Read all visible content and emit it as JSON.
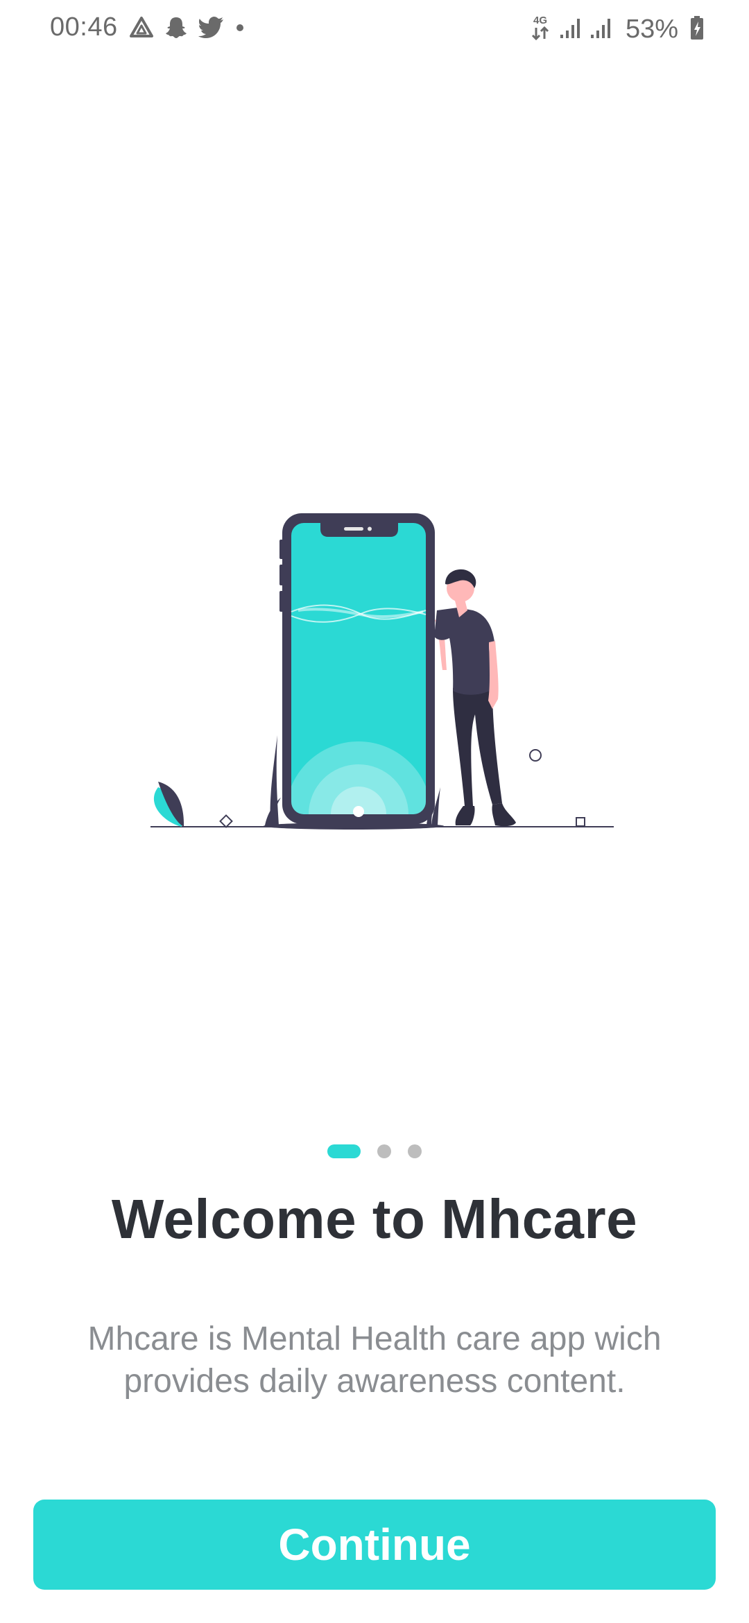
{
  "status_bar": {
    "time": "00:46",
    "left_icons": [
      "drive-icon",
      "snapchat-icon",
      "twitter-icon",
      "notification-dot-icon"
    ],
    "network_label": "4G",
    "battery_percent": "53%",
    "right_icons": [
      "network-4g-icon",
      "signal-icon",
      "signal-icon",
      "battery-charging-icon"
    ]
  },
  "colors": {
    "accent": "#2bd9d4",
    "title": "#2e3137",
    "subtitle": "#8a8d91",
    "illustration_dark": "#3f3d56",
    "skin": "#ffb8b8"
  },
  "pager": {
    "total": 3,
    "active_index": 0
  },
  "onboarding": {
    "title": "Welcome to Mhcare",
    "description": "Mhcare is Mental Health care app wich provides daily awareness content.",
    "continue_label": "Continue"
  }
}
